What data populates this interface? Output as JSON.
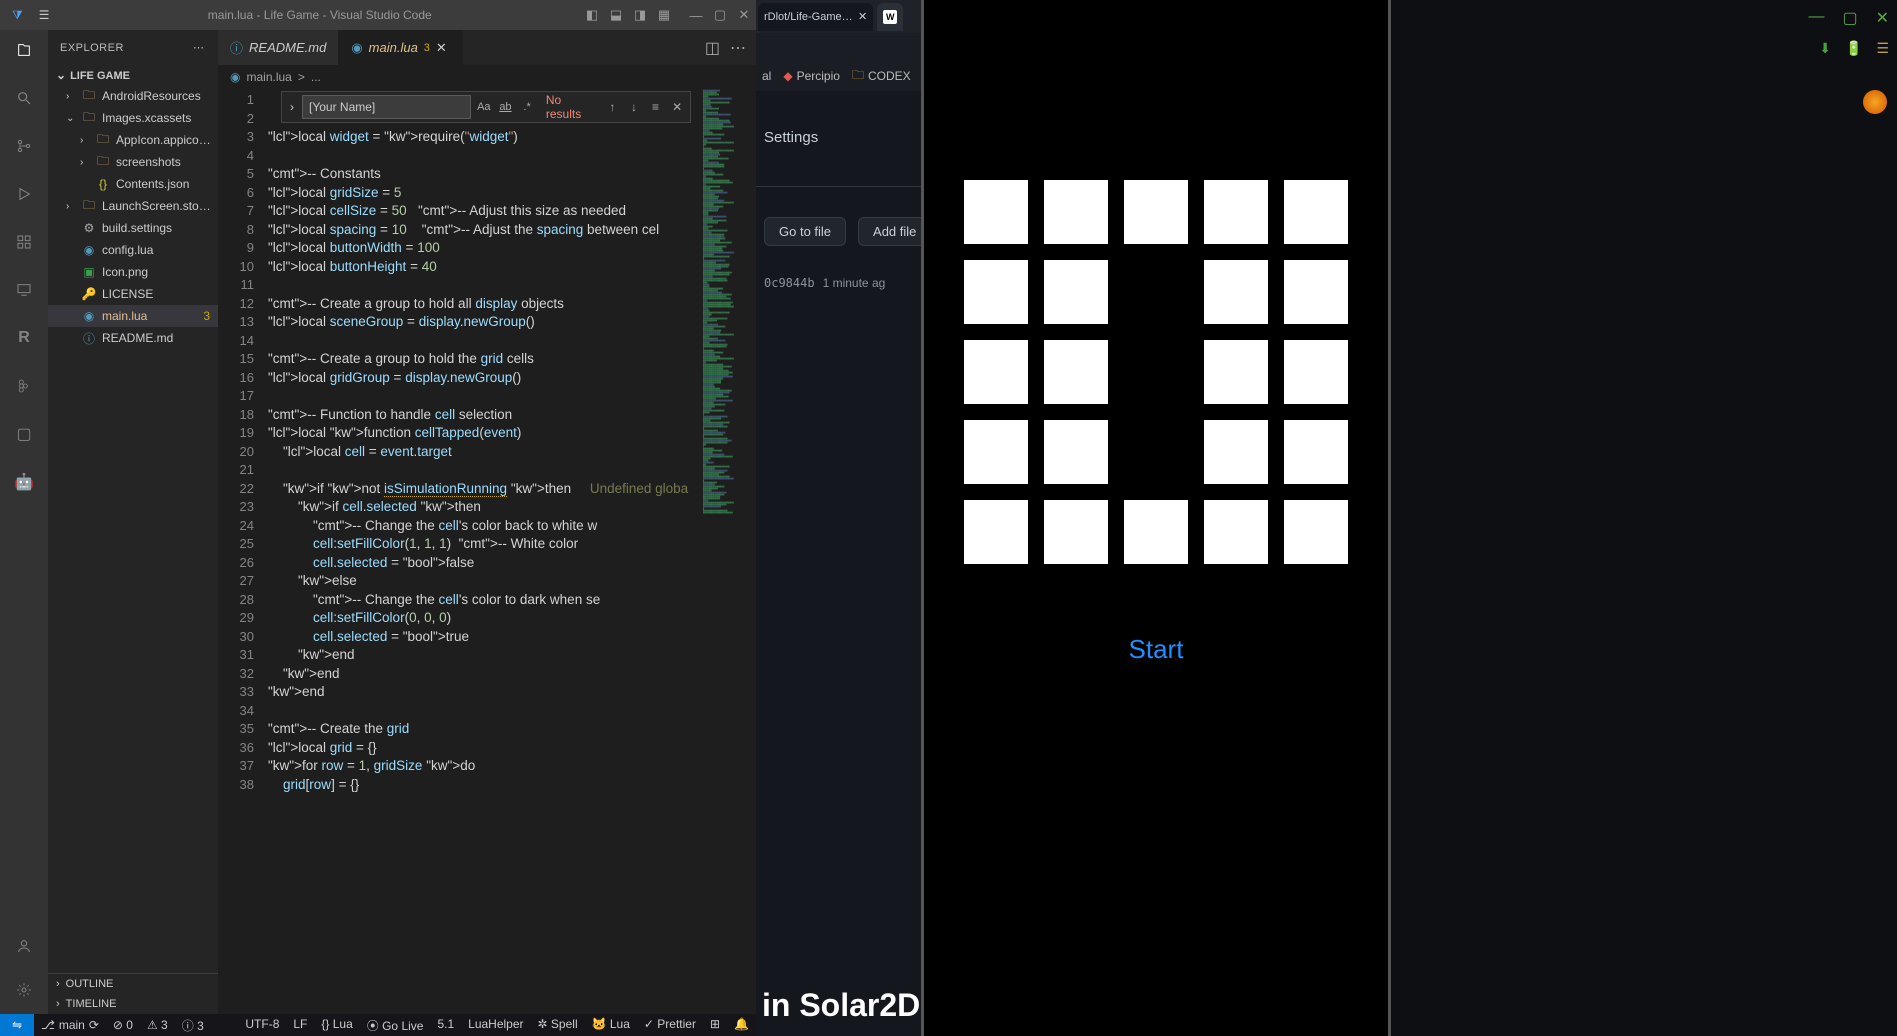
{
  "window": {
    "title": "main.lua - Life Game - Visual Studio Code"
  },
  "explorer": {
    "title": "EXPLORER",
    "project": "LIFE GAME",
    "outline": "OUTLINE",
    "timeline": "TIMELINE",
    "tree": [
      {
        "depth": 1,
        "kind": "folder",
        "open": false,
        "label": "AndroidResources"
      },
      {
        "depth": 1,
        "kind": "folder",
        "open": true,
        "label": "Images.xcassets"
      },
      {
        "depth": 2,
        "kind": "folder",
        "open": false,
        "label": "AppIcon.appico…"
      },
      {
        "depth": 2,
        "kind": "folder",
        "open": false,
        "label": "screenshots"
      },
      {
        "depth": 2,
        "kind": "file",
        "icon": "{}",
        "iconColor": "#cbcb41",
        "label": "Contents.json"
      },
      {
        "depth": 1,
        "kind": "folder",
        "open": false,
        "label": "LaunchScreen.sto…"
      },
      {
        "depth": 1,
        "kind": "file",
        "icon": "⚙",
        "iconColor": "#aaa",
        "label": "build.settings"
      },
      {
        "depth": 1,
        "kind": "file",
        "icon": "◉",
        "iconColor": "#519aba",
        "label": "config.lua"
      },
      {
        "depth": 1,
        "kind": "file",
        "icon": "▣",
        "iconColor": "#3c9e4b",
        "label": "Icon.png"
      },
      {
        "depth": 1,
        "kind": "file",
        "icon": "🔑",
        "iconColor": "#cbcb41",
        "label": "LICENSE"
      },
      {
        "depth": 1,
        "kind": "file",
        "icon": "◉",
        "iconColor": "#519aba",
        "label": "main.lua",
        "selected": true,
        "modified": true,
        "badge": "3"
      },
      {
        "depth": 1,
        "kind": "file",
        "icon": "ⓘ",
        "iconColor": "#519aba",
        "label": "README.md"
      }
    ]
  },
  "tabs": {
    "list": [
      {
        "icon": "ⓘ",
        "label": "README.md"
      },
      {
        "icon": "◉",
        "label": "main.lua",
        "badge": "3",
        "active": true,
        "modified": true,
        "close": true
      }
    ]
  },
  "breadcrumb": {
    "file": "main.lua",
    "sep": ">",
    "rest": "..."
  },
  "find": {
    "value": "[Your Name]",
    "noresults": "No results"
  },
  "code_lines": [
    "",
    "",
    "local widget = require(\"widget\")",
    "",
    "-- Constants",
    "local gridSize = 5",
    "local cellSize = 50   -- Adjust this size as needed",
    "local spacing = 10    -- Adjust the spacing between cel",
    "local buttonWidth = 100",
    "local buttonHeight = 40",
    "",
    "-- Create a group to hold all display objects",
    "local sceneGroup = display.newGroup()",
    "",
    "-- Create a group to hold the grid cells",
    "local gridGroup = display.newGroup()",
    "",
    "-- Function to handle cell selection",
    "local function cellTapped(event)",
    "    local cell = event.target",
    "",
    "    if not isSimulationRunning then     Undefined globa",
    "        if cell.selected then",
    "            -- Change the cell's color back to white w",
    "            cell:setFillColor(1, 1, 1)  -- White color",
    "            cell.selected = false",
    "        else",
    "            -- Change the cell's color to dark when se",
    "            cell:setFillColor(0, 0, 0)",
    "            cell.selected = true",
    "        end",
    "    end",
    "end",
    "",
    "-- Create the grid",
    "local grid = {}",
    "for row = 1, gridSize do",
    "    grid[row] = {}"
  ],
  "status": {
    "branch_icon": "⎇",
    "branch": "main",
    "sync": "⟳",
    "err": "⊘ 0",
    "warn": "⚠ 3",
    "info": "ⓘ 3",
    "encoding": "UTF-8",
    "eol": "LF",
    "lang": "{} Lua",
    "golive": "⦿ Go Live",
    "ver": "5.1",
    "helper": "LuaHelper",
    "spell": "✲ Spell",
    "lua2": "🐱 Lua",
    "prettier": "✓ Prettier",
    "bell": "🔔",
    "layout": "⊞"
  },
  "browser": {
    "tab1": "rDlot/Life-Game---A",
    "tab2": "W",
    "bookmark1": "al",
    "bookmark2": "Percipio",
    "bookmark3": "CODEX",
    "settings": "Settings",
    "goto": "Go to file",
    "addfile": "Add file",
    "sha": "0c9844b",
    "time": "1 minute ag",
    "bigtitle": "in Solar2D"
  },
  "simulator": {
    "start": "Start",
    "dark_cells": [
      7,
      12,
      17
    ]
  }
}
